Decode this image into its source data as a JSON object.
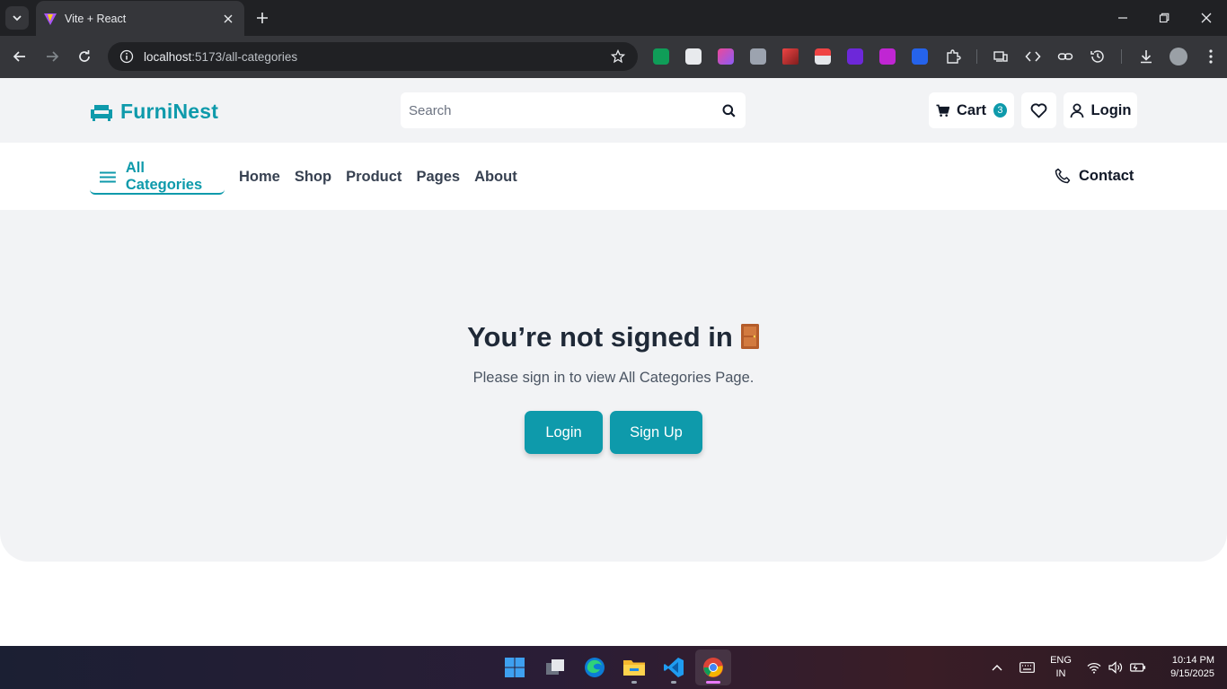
{
  "browser": {
    "tab_title": "Vite + React",
    "url_host": "localhost",
    "url_path": ":5173/all-categories"
  },
  "site": {
    "logo_text": "FurniNest",
    "search_placeholder": "Search",
    "cart_label": "Cart",
    "cart_count": "3",
    "login_label": "Login",
    "nav": {
      "all_categories": "All Categories",
      "links": [
        "Home",
        "Shop",
        "Product",
        "Pages",
        "About"
      ],
      "contact": "Contact"
    },
    "notice": {
      "title": "You’re not signed in",
      "subtitle": "Please sign in to view All Categories Page.",
      "login_button": "Login",
      "signup_button": "Sign Up"
    }
  },
  "taskbar": {
    "lang_line1": "ENG",
    "lang_line2": "IN",
    "time": "10:14 PM",
    "date": "9/15/2025"
  },
  "colors": {
    "brand": "#0e9aab",
    "page_bg": "#f2f3f5"
  }
}
